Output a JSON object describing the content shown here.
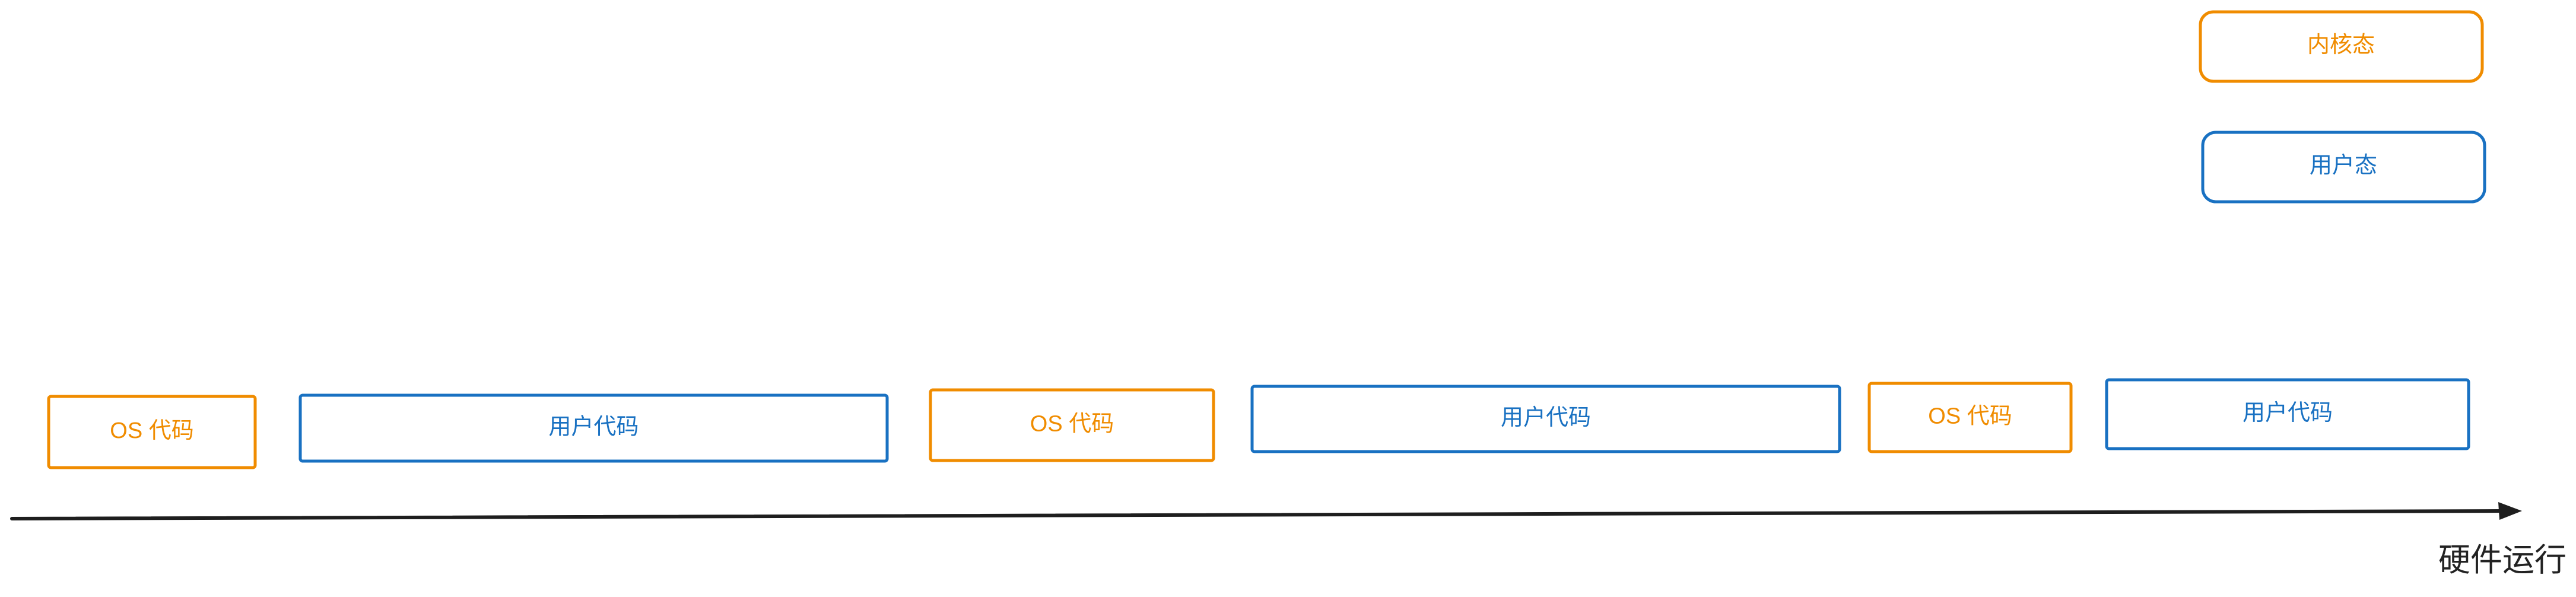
{
  "colors": {
    "kernel": "#f08c00",
    "user": "#1971c2",
    "axis": "#1e1e1e"
  },
  "legend": {
    "kernel_label": "内核态",
    "user_label": "用户态"
  },
  "timeline": {
    "axis_label": "硬件运行",
    "segments": [
      {
        "label": "OS 代码",
        "mode": "kernel"
      },
      {
        "label": "用户代码",
        "mode": "user"
      },
      {
        "label": "OS 代码",
        "mode": "kernel"
      },
      {
        "label": "用户代码",
        "mode": "user"
      },
      {
        "label": "OS 代码",
        "mode": "kernel"
      },
      {
        "label": "用户代码",
        "mode": "user"
      }
    ]
  }
}
